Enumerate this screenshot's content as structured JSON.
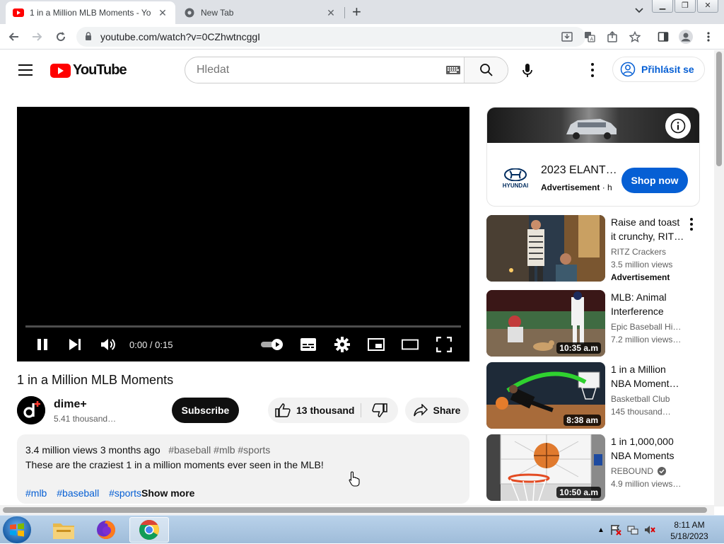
{
  "browser": {
    "tabs": [
      {
        "title": "1 in a Million MLB Moments - Yo",
        "active": true
      },
      {
        "title": "New Tab",
        "active": false
      }
    ],
    "url": "youtube.com/watch?v=0CZhwtncggI"
  },
  "header": {
    "logo_text": "YouTube",
    "search_placeholder": "Hledat",
    "signin_label": "Přihlásit se"
  },
  "player": {
    "time": "0:00 / 0:15",
    "progress": 0
  },
  "video": {
    "title": "1 in a Million MLB Moments",
    "channel": "dime+",
    "avatar_letter": "d",
    "subscribers": "5.41 thousand…",
    "subscribe_label": "Subscribe",
    "likes": "13 thousand",
    "share_label": "Share",
    "description": {
      "stats": "3.4 million views  3 months ago",
      "tags": "#baseball #mlb #sports",
      "text": "These are the craziest 1 in a million moments ever seen in the MLB!",
      "links": [
        "#mlb",
        "#baseball",
        "#sports"
      ],
      "show_more": "Show more"
    }
  },
  "sidebar": {
    "ad": {
      "brand": "HYUNDAI",
      "title": "2023 ELANT…",
      "label": "Advertisement",
      "sub_rest": " · h",
      "cta": "Shop now"
    },
    "recommendations": [
      {
        "title": "Raise and toast it crunchy, RIT…",
        "channel": "RITZ Crackers",
        "views": "3.5 million views",
        "ad_label": "Advertisement",
        "duration": ""
      },
      {
        "title": "MLB: Animal Interference",
        "channel": "Epic Baseball Hi…",
        "views": "7.2 million views…",
        "ad_label": "",
        "duration": "10:35 a.m"
      },
      {
        "title": "1 in a Million NBA Moment…",
        "channel": "Basketball Club",
        "views": "145 thousand…",
        "ad_label": "",
        "duration": "8:38 am"
      },
      {
        "title": "1 in 1,000,000 NBA Moments",
        "channel": "REBOUND",
        "views": "4.9 million views…",
        "ad_label": "",
        "duration": "10:50 a.m"
      }
    ]
  },
  "taskbar": {
    "time": "8:11 AM",
    "date": "5/18/2023"
  },
  "colors": {
    "yt_red": "#ff0000",
    "link_blue": "#065fd4",
    "chip_bg": "#f2f2f2"
  }
}
